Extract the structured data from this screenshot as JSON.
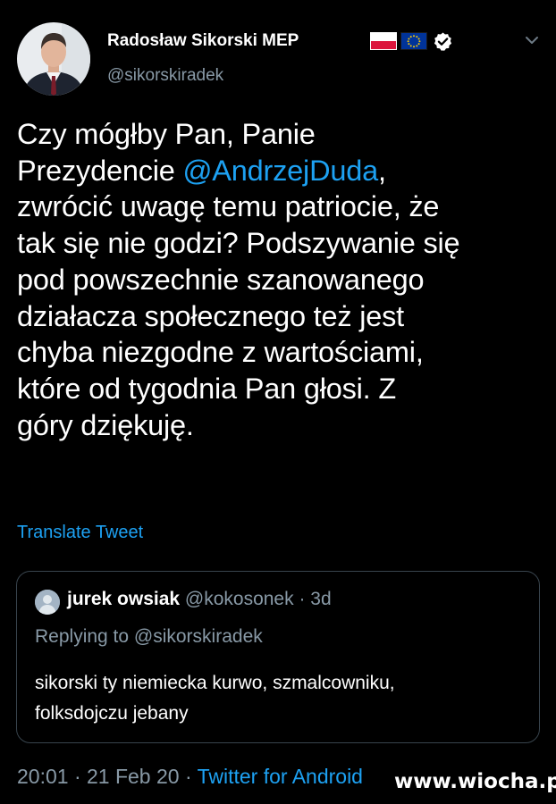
{
  "tweet": {
    "author": {
      "display_name": "Radosław Sikorski MEP",
      "handle": "@sikorskiradek",
      "verified_icon": "verified-badge-icon",
      "flags": [
        "poland-flag",
        "eu-flag"
      ]
    },
    "text_lines": [
      {
        "before": "Czy mógłby Pan, Panie",
        "mention": "",
        "after": ""
      },
      {
        "before": "Prezydencie ",
        "mention": "@AndrzejDuda",
        "after": ","
      },
      {
        "before": "zwrócić uwagę temu patriocie, że",
        "mention": "",
        "after": ""
      },
      {
        "before": "tak się nie godzi? Podszywanie się",
        "mention": "",
        "after": ""
      },
      {
        "before": "pod powszechnie szanowanego",
        "mention": "",
        "after": ""
      },
      {
        "before": "działacza społecznego też jest",
        "mention": "",
        "after": ""
      },
      {
        "before": "chyba niezgodne z wartościami,",
        "mention": "",
        "after": ""
      },
      {
        "before": "które od tygodnia Pan głosi. Z",
        "mention": "",
        "after": ""
      },
      {
        "before": "góry dziękuję.",
        "mention": "",
        "after": ""
      }
    ],
    "translate_label": "Translate Tweet",
    "quoted": {
      "name": "jurek owsiak",
      "meta": " @kokosonek · 3d",
      "replying_to": "Replying to @sikorskiradek",
      "text_lines": [
        "sikorski ty niemiecka kurwo, szmalcowniku,",
        "folksdojczu jebany"
      ]
    },
    "footer": {
      "time_date": "20:01 · 21 Feb 20 · ",
      "client": "Twitter for Android"
    }
  },
  "watermark": "www.wiocha.pl",
  "colors": {
    "background": "#000000",
    "text": "#ffffff",
    "secondary_text": "#8899a6",
    "link": "#1da1f2",
    "card_border": "#38444d"
  }
}
